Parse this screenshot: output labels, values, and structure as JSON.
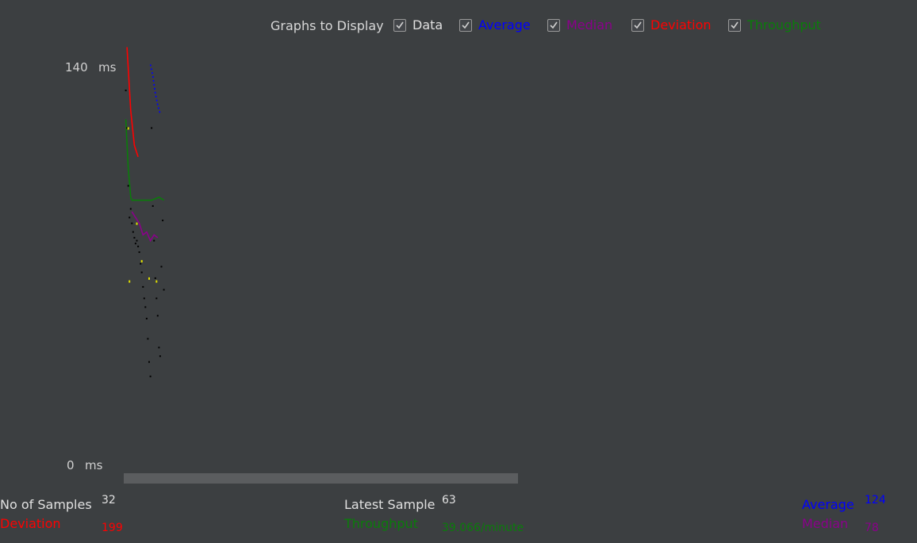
{
  "legend": {
    "title": "Graphs to Display",
    "items": [
      {
        "label": "Data",
        "checked": true,
        "color": "#e0e0e0"
      },
      {
        "label": "Average",
        "checked": true,
        "color": "#0000ff"
      },
      {
        "label": "Median",
        "checked": true,
        "color": "#8b008b"
      },
      {
        "label": "Deviation",
        "checked": true,
        "color": "#ff0000"
      },
      {
        "label": "Throughput",
        "checked": true,
        "color": "#0a7d0a"
      }
    ]
  },
  "axis": {
    "y_max_value": "140",
    "y_min_value": "0",
    "unit": "ms"
  },
  "stats": {
    "samples_label": "No of Samples",
    "samples_value": "32",
    "deviation_label": "Deviation",
    "deviation_value": "199",
    "latest_label": "Latest Sample",
    "latest_value": "63",
    "throughput_label": "Throughput",
    "throughput_value": "39.066/minute",
    "average_label": "Average",
    "average_value": "124",
    "median_label": "Median",
    "median_value": "78"
  },
  "chart_data": {
    "type": "scatter",
    "ylim": [
      0,
      140
    ],
    "yunit": "ms",
    "data_points": [
      {
        "x": 1,
        "y": 132
      },
      {
        "x": 2,
        "y": 119
      },
      {
        "x": 3,
        "y": 99
      },
      {
        "x": 4,
        "y": 88
      },
      {
        "x": 5,
        "y": 91
      },
      {
        "x": 6,
        "y": 86
      },
      {
        "x": 7,
        "y": 83
      },
      {
        "x": 8,
        "y": 81
      },
      {
        "x": 9,
        "y": 79
      },
      {
        "x": 10,
        "y": 80
      },
      {
        "x": 11,
        "y": 78
      },
      {
        "x": 12,
        "y": 76
      },
      {
        "x": 13,
        "y": 72
      },
      {
        "x": 14,
        "y": 69
      },
      {
        "x": 15,
        "y": 64
      },
      {
        "x": 16,
        "y": 60
      },
      {
        "x": 17,
        "y": 57
      },
      {
        "x": 18,
        "y": 53
      },
      {
        "x": 19,
        "y": 46
      },
      {
        "x": 20,
        "y": 38
      },
      {
        "x": 21,
        "y": 33
      },
      {
        "x": 22,
        "y": 119
      },
      {
        "x": 23,
        "y": 92
      },
      {
        "x": 24,
        "y": 80
      },
      {
        "x": 25,
        "y": 67
      },
      {
        "x": 26,
        "y": 60
      },
      {
        "x": 27,
        "y": 54
      },
      {
        "x": 28,
        "y": 43
      },
      {
        "x": 29,
        "y": 40
      },
      {
        "x": 30,
        "y": 71
      },
      {
        "x": 31,
        "y": 87
      },
      {
        "x": 32,
        "y": 63
      }
    ],
    "series": [
      {
        "name": "Average",
        "color": "#0000ff",
        "points": [
          [
            21,
            141
          ],
          [
            23,
            137
          ],
          [
            25,
            131
          ],
          [
            27,
            127
          ],
          [
            29,
            124
          ]
        ]
      },
      {
        "name": "Median",
        "color": "#8b008b",
        "points": [
          [
            6,
            90
          ],
          [
            9,
            88
          ],
          [
            12,
            86
          ],
          [
            15,
            82
          ],
          [
            18,
            83
          ],
          [
            21,
            80
          ],
          [
            24,
            82
          ],
          [
            27,
            81
          ]
        ]
      },
      {
        "name": "Deviation",
        "color": "#ff0000",
        "points": [
          [
            2,
            147
          ],
          [
            5,
            125
          ],
          [
            8,
            113
          ],
          [
            11,
            109
          ]
        ]
      },
      {
        "name": "Throughput",
        "color": "#0a7d0a",
        "points": [
          [
            1,
            122
          ],
          [
            3,
            105
          ],
          [
            5,
            95
          ],
          [
            6,
            94
          ],
          [
            10,
            94
          ],
          [
            16,
            94
          ],
          [
            22,
            94
          ],
          [
            28,
            95
          ],
          [
            32,
            94
          ]
        ]
      }
    ],
    "highlight_points": [
      {
        "x": 3,
        "y": 119,
        "color": "#e0e000"
      },
      {
        "x": 10,
        "y": 86,
        "color": "#e0e000"
      },
      {
        "x": 14,
        "y": 73,
        "color": "#e0e000"
      },
      {
        "x": 20,
        "y": 67,
        "color": "#e0e000"
      },
      {
        "x": 26,
        "y": 66,
        "color": "#e0e000"
      },
      {
        "x": 4,
        "y": 66,
        "color": "#e0e000"
      }
    ]
  }
}
